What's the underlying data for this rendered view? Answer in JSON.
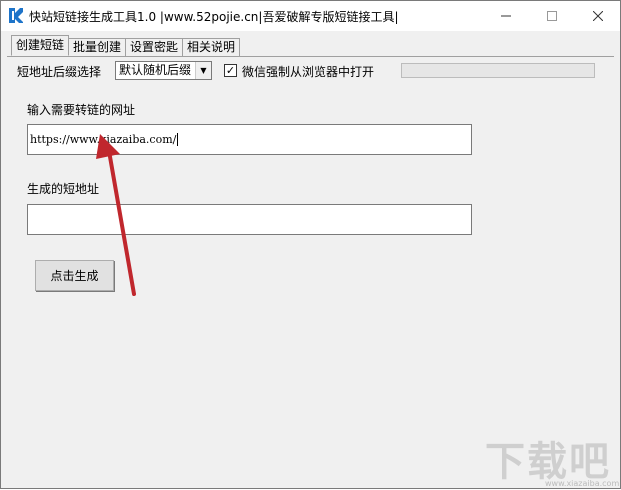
{
  "window": {
    "title": "快站短链接生成工具1.0 |www.52pojie.cn|吾爱破解专版短链接工具|",
    "minimize_icon": "minimize-icon",
    "maximize_icon": "maximize-icon",
    "close_icon": "close-icon"
  },
  "tabs": [
    {
      "label": "创建短链",
      "active": true
    },
    {
      "label": "批量创建",
      "active": false
    },
    {
      "label": "设置密匙",
      "active": false
    },
    {
      "label": "相关说明",
      "active": false
    }
  ],
  "settings": {
    "suffix_label": "短地址后缀选择",
    "suffix_value": "默认随机后缀",
    "wechat_force_label": "微信强制从浏览器中打开",
    "wechat_force_checked": true
  },
  "main": {
    "input_label": "输入需要转链的网址",
    "input_value": "https://www.xiazaiba.com/",
    "output_label": "生成的短地址",
    "output_value": "",
    "generate_button": "点击生成"
  },
  "watermark": {
    "text": "下载吧",
    "sub": "www.xiazaiba.com"
  },
  "colors": {
    "annotation_arrow": "#c0272d",
    "window_bg": "#f0f0f0",
    "app_icon": "#1e74c9"
  }
}
